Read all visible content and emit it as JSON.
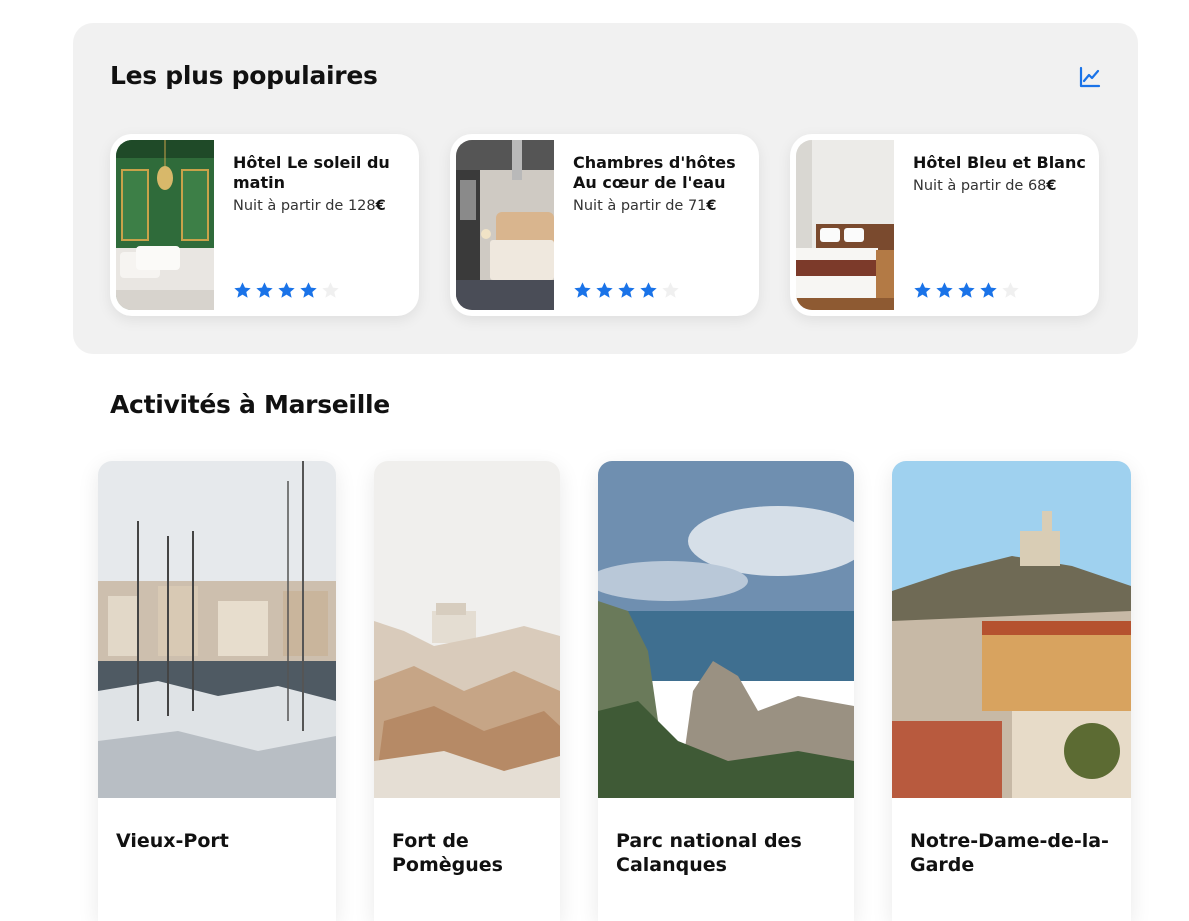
{
  "popular": {
    "title": "Les plus populaires",
    "icon": "trend-chart-icon",
    "accent_color": "#1a73e8",
    "hotels": [
      {
        "name": "Hôtel Le soleil du matin",
        "price_prefix": "Nuit à partir de ",
        "price": "128",
        "currency": "€",
        "rating": 4,
        "max_rating": 5
      },
      {
        "name": "Chambres d'hôtes Au cœur de l'eau",
        "price_prefix": "Nuit à partir de ",
        "price": "71",
        "currency": "€",
        "rating": 4,
        "max_rating": 5
      },
      {
        "name": "Hôtel Bleu et Blanc",
        "price_prefix": "Nuit à partir de ",
        "price": "68",
        "currency": "€",
        "rating": 4,
        "max_rating": 5
      }
    ]
  },
  "activities": {
    "title": "Activités à Marseille",
    "items": [
      {
        "name": "Vieux-Port"
      },
      {
        "name": "Fort de Pomègues"
      },
      {
        "name": "Parc national des Calanques"
      },
      {
        "name": "Notre-Dame-de-la-Garde"
      }
    ]
  }
}
